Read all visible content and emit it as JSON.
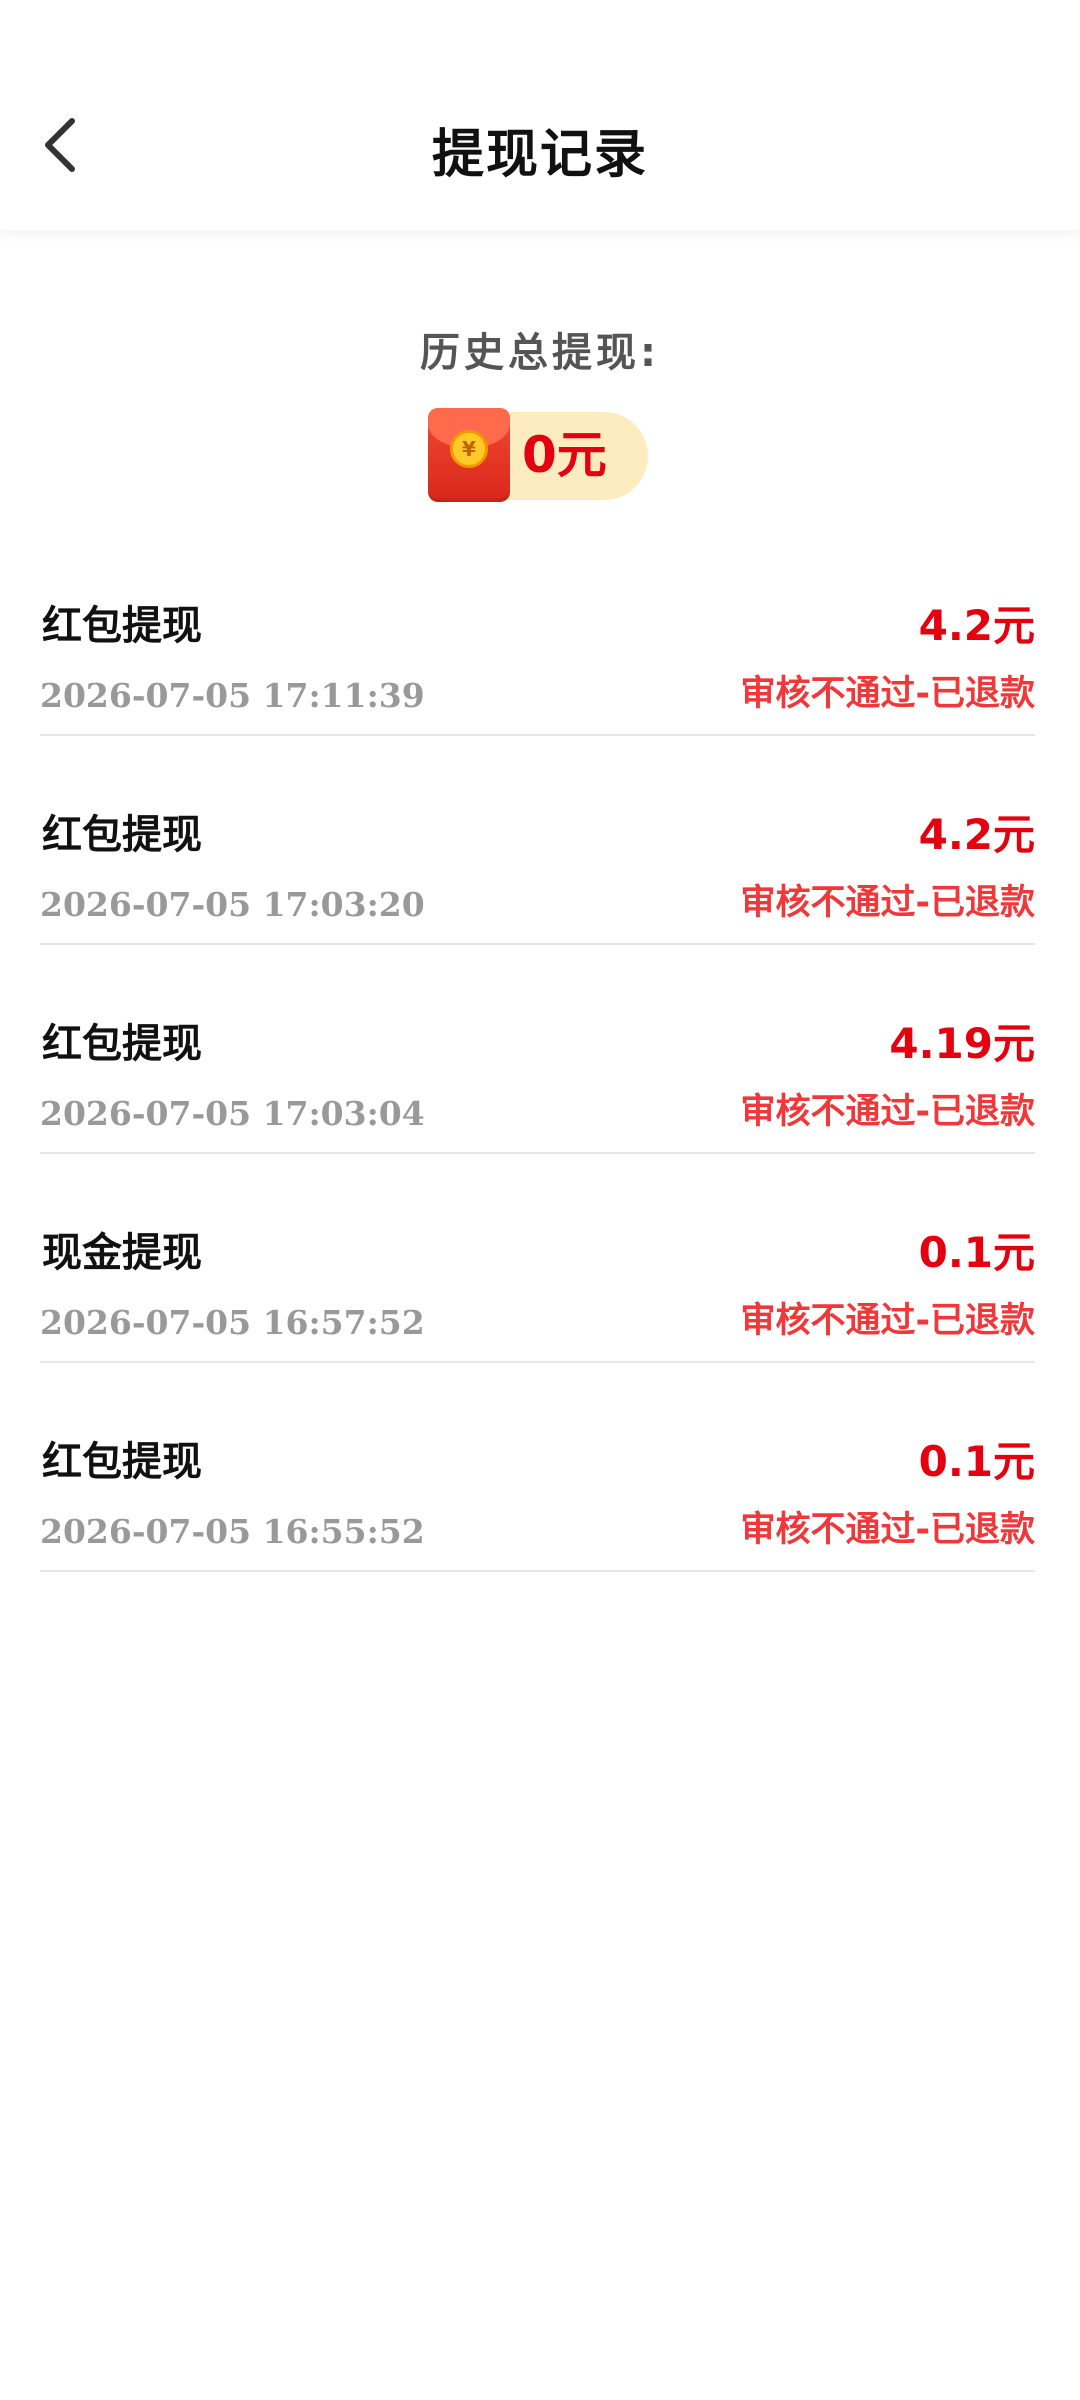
{
  "header": {
    "title": "提现记录"
  },
  "summary": {
    "label": "历史总提现:",
    "total": "0元",
    "coin_symbol": "¥",
    "icon": "red-envelope-icon"
  },
  "records": [
    {
      "title": "红包提现",
      "amount": "4.2元",
      "time": "2026-07-05 17:11:39",
      "status": "审核不通过-已退款"
    },
    {
      "title": "红包提现",
      "amount": "4.2元",
      "time": "2026-07-05 17:03:20",
      "status": "审核不通过-已退款"
    },
    {
      "title": "红包提现",
      "amount": "4.19元",
      "time": "2026-07-05 17:03:04",
      "status": "审核不通过-已退款"
    },
    {
      "title": "现金提现",
      "amount": "0.1元",
      "time": "2026-07-05 16:57:52",
      "status": "审核不通过-已退款"
    },
    {
      "title": "红包提现",
      "amount": "0.1元",
      "time": "2026-07-05 16:55:52",
      "status": "审核不通过-已退款"
    }
  ],
  "colors": {
    "accent_red": "#e4000f",
    "status_red": "#f0383a",
    "pill_bg": "#fdecc0"
  }
}
